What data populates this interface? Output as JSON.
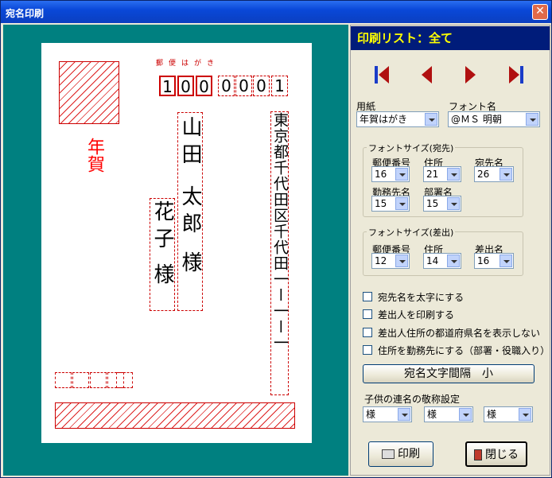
{
  "window": {
    "title": "宛名印刷",
    "close_glyph": "✕"
  },
  "preview": {
    "postal_label": "郵便はがき",
    "nenga": "年賀",
    "zip_digits": [
      "1",
      "0",
      "0",
      "0",
      "0",
      "0",
      "1"
    ],
    "address": "東京都千代田区千代田一ー一ー一",
    "recipient_surname": "山田",
    "recipient_given": "太郎",
    "honorific": "様",
    "second_given": "花子",
    "second_honorific": "様"
  },
  "panel": {
    "list_title": "印刷リスト：全て",
    "paper_label": "用紙",
    "paper_value": "年賀はがき",
    "font_label": "フォント名",
    "font_value": "@ＭＳ 明朝",
    "recipient_group": {
      "title": "フォントサイズ(宛先)",
      "zip_label": "郵便番号",
      "zip_value": "16",
      "addr_label": "住所",
      "addr_value": "21",
      "name_label": "宛先名",
      "name_value": "26",
      "office_label": "勤務先名",
      "office_value": "15",
      "dept_label": "部署名",
      "dept_value": "15"
    },
    "sender_group": {
      "title": "フォントサイズ(差出)",
      "zip_label": "郵便番号",
      "zip_value": "12",
      "addr_label": "住所",
      "addr_value": "14",
      "name_label": "差出名",
      "name_value": "16"
    },
    "checks": [
      "宛先名を太字にする",
      "差出人を印刷する",
      "差出人住所の都道府県名を表示しない",
      "住所を勤務先にする（部署・役職入り）"
    ],
    "spacing_button": "宛名文字間隔　小",
    "children_label": "子供の連名の敬称設定",
    "children_values": [
      "様",
      "様",
      "様"
    ],
    "print_button": "印刷",
    "close_button": "閉じる"
  },
  "colors": {
    "accent": "#cc0000",
    "teal": "#008080",
    "nav_blue": "#001c7a",
    "list_title_text": "#ffff00"
  }
}
